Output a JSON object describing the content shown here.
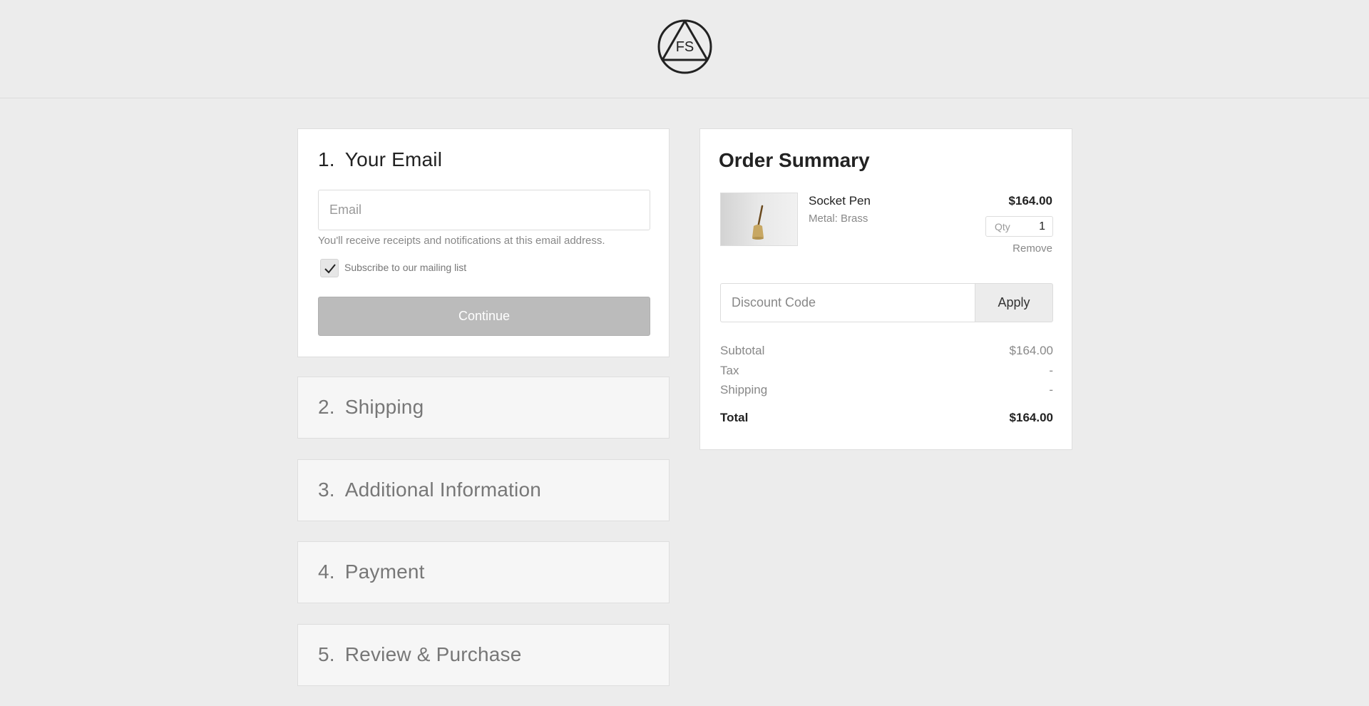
{
  "header": {
    "logo_text": "FS",
    "logo_icon": "fs-triangle-circle-logo"
  },
  "steps": [
    {
      "number": "1.",
      "title": "Your Email"
    },
    {
      "number": "2.",
      "title": "Shipping"
    },
    {
      "number": "3.",
      "title": "Additional Information"
    },
    {
      "number": "4.",
      "title": "Payment"
    },
    {
      "number": "5.",
      "title": "Review & Purchase"
    }
  ],
  "email_step": {
    "email_placeholder": "Email",
    "email_value": "",
    "helper_text": "You'll receive receipts and notifications at this email address.",
    "subscribe_label": "Subscribe to our mailing list",
    "subscribe_checked": true,
    "continue_label": "Continue"
  },
  "summary": {
    "title": "Order Summary",
    "item": {
      "name": "Socket Pen",
      "variant": "Metal: Brass",
      "price": "$164.00",
      "qty_label": "Qty",
      "qty_value": "1",
      "remove_label": "Remove"
    },
    "discount_placeholder": "Discount Code",
    "apply_label": "Apply",
    "lines": [
      {
        "label": "Subtotal",
        "value": "$164.00"
      },
      {
        "label": "Tax",
        "value": "-"
      },
      {
        "label": "Shipping",
        "value": "-"
      }
    ],
    "total": {
      "label": "Total",
      "value": "$164.00"
    }
  },
  "colors": {
    "background": "#ececec",
    "card": "#ffffff",
    "collapsed_card": "#f6f6f6",
    "button_disabled": "#bbbbbb",
    "text_primary": "#222222",
    "text_muted": "#888888"
  }
}
